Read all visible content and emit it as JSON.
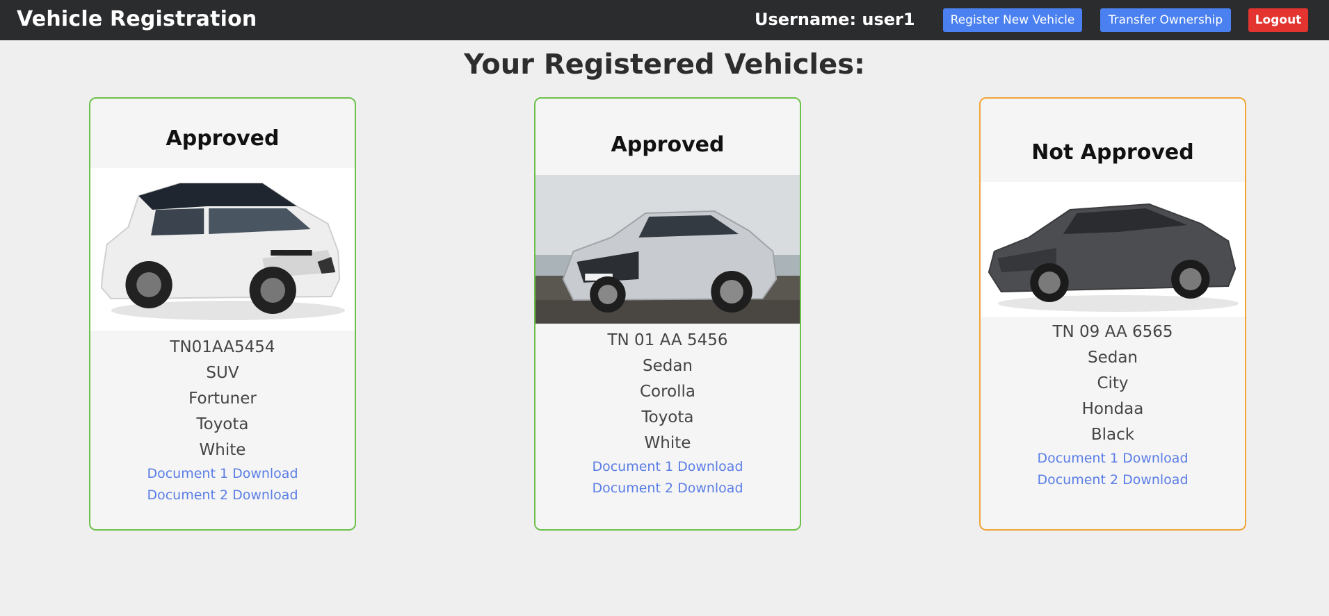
{
  "header": {
    "brand": "Vehicle Registration",
    "username_label": "Username: user1",
    "register_label": "Register New Vehicle",
    "transfer_label": "Transfer Ownership",
    "logout_label": "Logout"
  },
  "main": {
    "title": "Your Registered Vehicles:"
  },
  "vehicles": [
    {
      "status": "Approved",
      "plate": "TN01AA5454",
      "type": "SUV",
      "model": "Fortuner",
      "make": "Toyota",
      "color": "White",
      "doc1": "Document 1 Download",
      "doc2": "Document 2 Download"
    },
    {
      "status": "Approved",
      "plate": "TN 01 AA 5456",
      "type": "Sedan",
      "model": "Corolla",
      "make": "Toyota",
      "color": "White",
      "doc1": "Document 1 Download",
      "doc2": "Document 2 Download"
    },
    {
      "status": "Not Approved",
      "plate": "TN 09 AA 6565",
      "type": "Sedan",
      "model": "City",
      "make": "Hondaa",
      "color": "Black",
      "doc1": "Document 1 Download",
      "doc2": "Document 2 Download"
    }
  ],
  "colors": {
    "approved_border": "#6cc04a",
    "not_approved_border": "#f2a437",
    "primary_button": "#4a80f0",
    "logout_button": "#e3342f",
    "link": "#5a7de6",
    "navbar": "#2b2c2e"
  }
}
